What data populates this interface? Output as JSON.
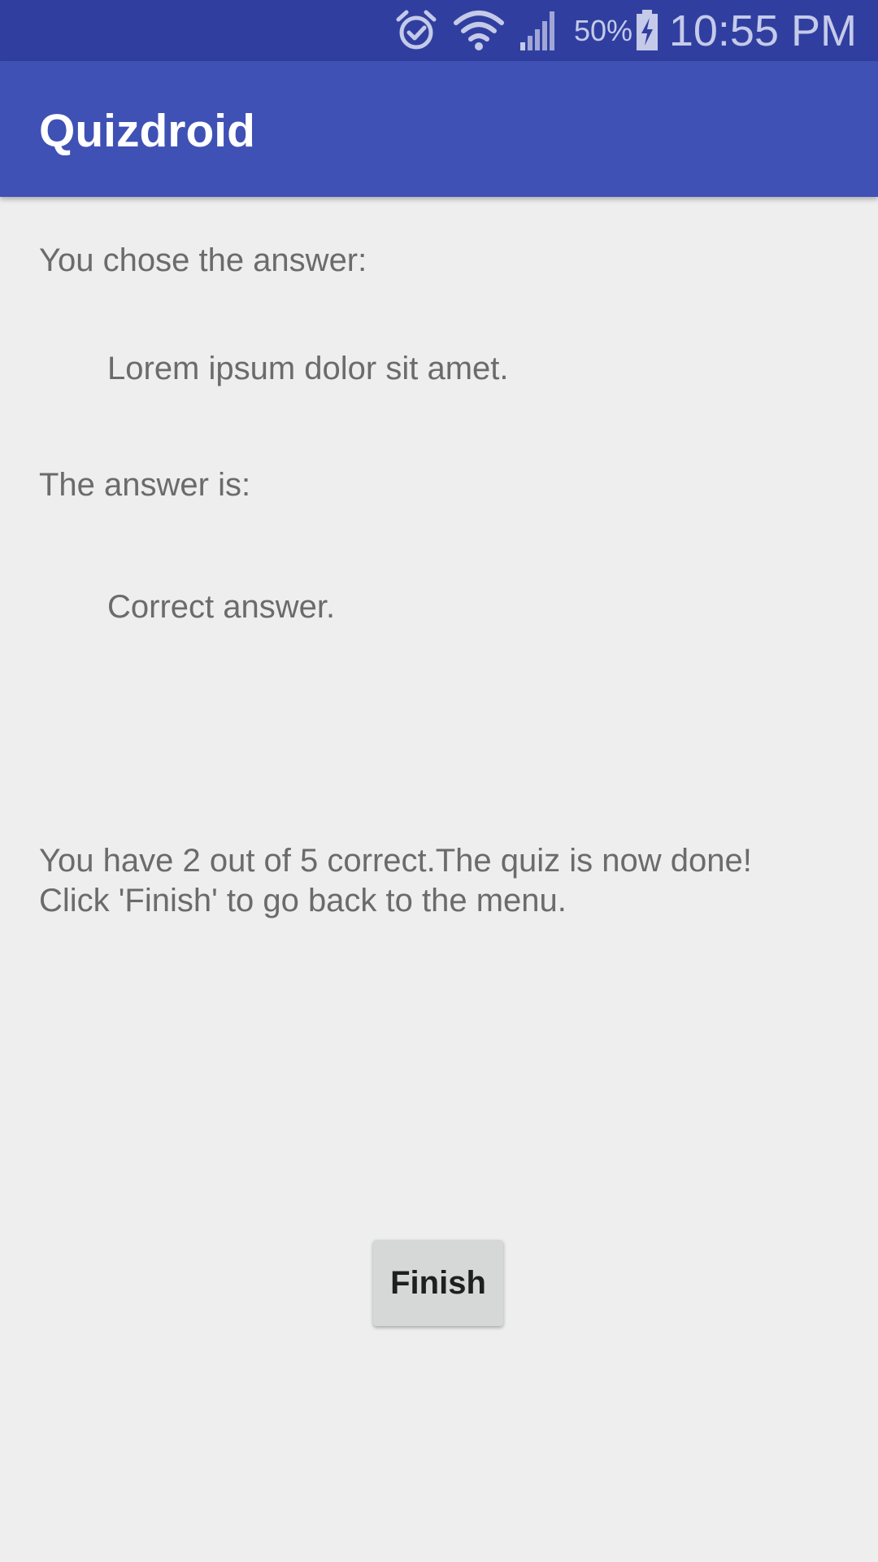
{
  "status_bar": {
    "icons": [
      "alarm-icon",
      "wifi-icon",
      "cell-signal-icon",
      "battery-charging-icon"
    ],
    "battery_percent": "50%",
    "time": "10:55 PM"
  },
  "app_bar": {
    "title": "Quizdroid"
  },
  "result": {
    "chosen_label": "You chose the answer:",
    "chosen_answer": "Lorem ipsum dolor sit amet.",
    "correct_label": "The answer is:",
    "correct_answer": "Correct answer.",
    "summary_line1": "You have 2 out of 5 correct.The quiz is now done!",
    "summary_line2": "Click 'Finish' to go back to the menu."
  },
  "actions": {
    "finish_label": "Finish"
  },
  "colors": {
    "status_bar": "#303f9f",
    "app_bar": "#3f51b5",
    "background": "#eeeeef",
    "body_text": "#6b6b6b",
    "button": "#d6d7d7"
  }
}
